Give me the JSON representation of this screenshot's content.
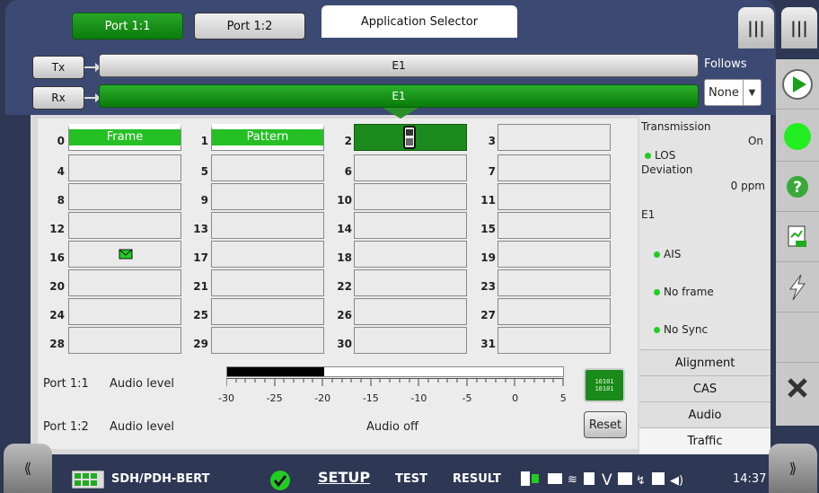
{
  "header": {
    "port_tabs": [
      "Port 1:1",
      "Port 1:2"
    ],
    "app_selector": "Application Selector"
  },
  "signal": {
    "tx_label": "Tx",
    "rx_label": "Rx",
    "tx_value": "E1",
    "rx_value": "E1",
    "follows_label": "Follows",
    "follows_value": "None"
  },
  "timeslots": {
    "labels": [
      "0",
      "1",
      "2",
      "3",
      "4",
      "5",
      "6",
      "7",
      "8",
      "9",
      "10",
      "11",
      "12",
      "13",
      "14",
      "15",
      "16",
      "17",
      "18",
      "19",
      "20",
      "21",
      "22",
      "23",
      "24",
      "25",
      "26",
      "27",
      "28",
      "29",
      "30",
      "31"
    ],
    "frame_label": "Frame",
    "pattern_label": "Pattern"
  },
  "audio": {
    "port1_label": "Port 1:1",
    "port2_label": "Port 1:2",
    "level_label": "Audio level",
    "level_label2": "Audio level",
    "audio_off": "Audio off",
    "scale": [
      "-30",
      "-25",
      "-20",
      "-15",
      "-10",
      "-5",
      "0",
      "5"
    ],
    "meter_fraction": 0.29,
    "icon_text": "10101 10101",
    "reset_label": "Reset"
  },
  "status": {
    "transmission_title": "Transmission",
    "transmission_value": "On",
    "los": "LOS",
    "deviation_title": "Deviation",
    "deviation_value": "0 ppm",
    "e1_title": "E1",
    "alarms": [
      "AIS",
      "No frame",
      "No Sync"
    ],
    "tabs": [
      "Alignment",
      "CAS",
      "Audio",
      "Traffic"
    ]
  },
  "bottom_bar": {
    "app_name": "SDH/PDH-BERT",
    "setup": "SETUP",
    "test": "TEST",
    "result": "RESULT",
    "time": "14:37"
  }
}
